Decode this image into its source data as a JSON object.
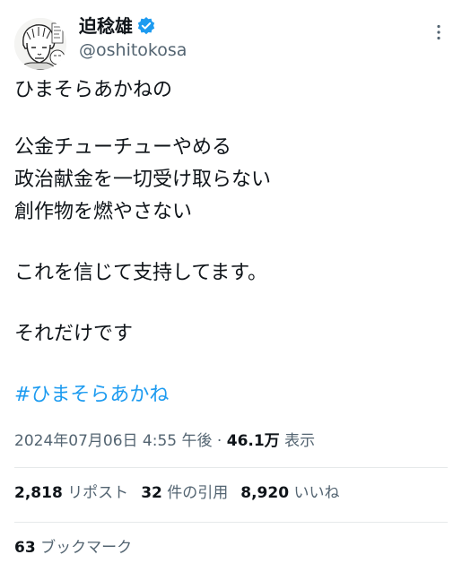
{
  "author": {
    "name": "迫稔雄",
    "handle": "@oshitokosa",
    "verified": true
  },
  "tweet": {
    "lines": [
      "ひまそらあかねの",
      "",
      "公金チューチューやめる",
      "政治献金を一切受け取らない",
      "創作物を燃やさない",
      "",
      "これを信じて支持してます。",
      "",
      "それだけです"
    ],
    "hashtag": "#ひまそらあかね"
  },
  "meta": {
    "timestamp": "2024年07月06日 4:55 午後",
    "separator": "·",
    "views_count": "46.1万",
    "views_label": "表示"
  },
  "stats": {
    "reposts_count": "2,818",
    "reposts_label": "リポスト",
    "quotes_count": "32",
    "quotes_label": "件の引用",
    "likes_count": "8,920",
    "likes_label": "いいね",
    "bookmarks_count": "63",
    "bookmarks_label": "ブックマーク"
  },
  "colors": {
    "link": "#1d9bf0",
    "secondary_text": "#536471",
    "primary_text": "#0f1419",
    "divider": "#e6e9ea"
  },
  "icons": [
    "verified-badge-icon",
    "more-options-icon"
  ]
}
